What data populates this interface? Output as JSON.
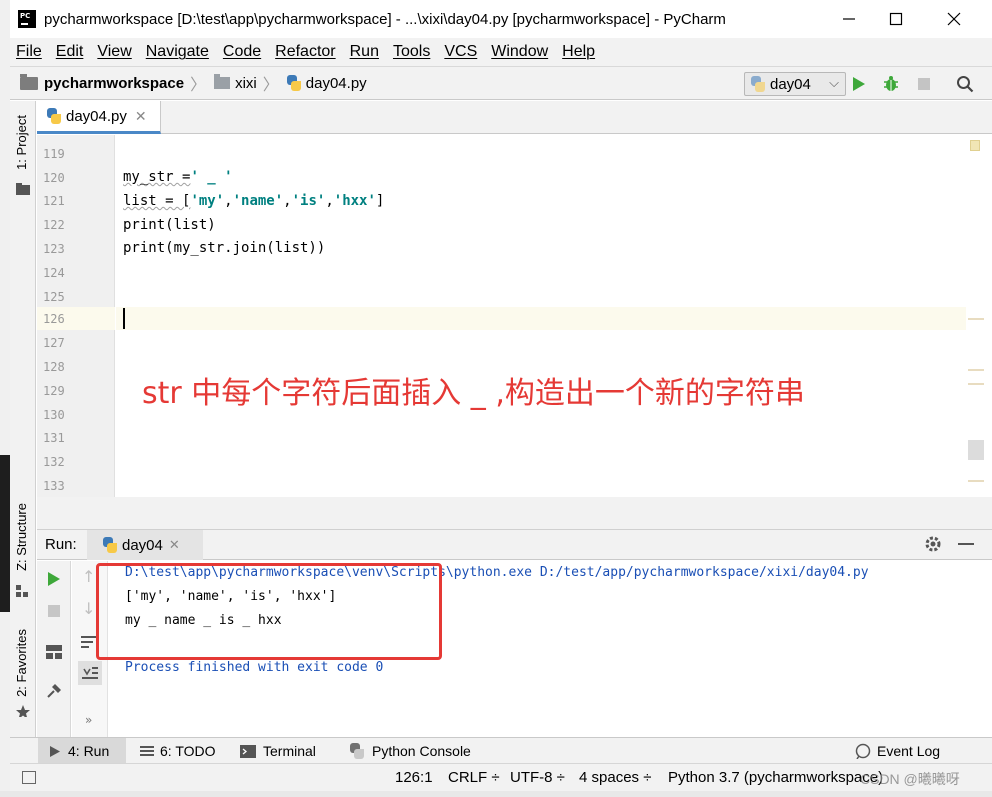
{
  "window": {
    "title": "pycharmworkspace [D:\\test\\app\\pycharmworkspace] - ...\\xixi\\day04.py [pycharmworkspace] - PyCharm",
    "logo_text": "PC"
  },
  "menu": [
    "File",
    "Edit",
    "View",
    "Navigate",
    "Code",
    "Refactor",
    "Run",
    "Tools",
    "VCS",
    "Window",
    "Help"
  ],
  "breadcrumb": {
    "project": "pycharmworkspace",
    "folder": "xixi",
    "file": "day04.py"
  },
  "run_config": {
    "label": "day04"
  },
  "left_tabs": {
    "project": "1: Project",
    "structure": "Z: Structure",
    "favorites": "2: Favorites"
  },
  "editor": {
    "tab_label": "day04.py",
    "line_numbers": [
      "119",
      "120",
      "121",
      "122",
      "123",
      "124",
      "125",
      "126",
      "127",
      "128",
      "129",
      "130",
      "131",
      "132",
      "133"
    ],
    "code": {
      "l120_a": "my_str =",
      "l120_b": "' _ '",
      "l121_a": "list = [",
      "l121_s1": "'my'",
      "l121_s2": "'name'",
      "l121_s3": "'is'",
      "l121_s4": "'hxx'",
      "l121_close": "]",
      "comma": ",",
      "l122": "print(list)",
      "l123": "print(my_str.join(list))"
    },
    "annotation": "str 中每个字符后面插入 _ ,构造出一个新的字符串"
  },
  "run_panel": {
    "title": "Run:",
    "tab_label": "day04",
    "output": [
      "D:\\test\\app\\pycharmworkspace\\venv\\Scripts\\python.exe D:/test/app/pycharmworkspace/xixi/day04.py",
      "['my', 'name', 'is', 'hxx']",
      "my _ name _ is _ hxx",
      "",
      "Process finished with exit code 0"
    ]
  },
  "bottom_tabs": {
    "run": "4: Run",
    "todo": "6: TODO",
    "terminal": "Terminal",
    "python_console": "Python Console",
    "event_log": "Event Log"
  },
  "status": {
    "position": "126:1",
    "line_sep": "CRLF ÷",
    "encoding": "UTF-8 ÷",
    "indent": "4 spaces ÷",
    "interpreter": "Python 3.7 (pycharmworkspace)",
    "watermark": "CSDN @曦曦呀"
  },
  "colors": {
    "run_green": "#3ea83a",
    "annotation_red": "#e53935",
    "string_teal": "#008080",
    "console_blue": "#1a4fb5"
  }
}
